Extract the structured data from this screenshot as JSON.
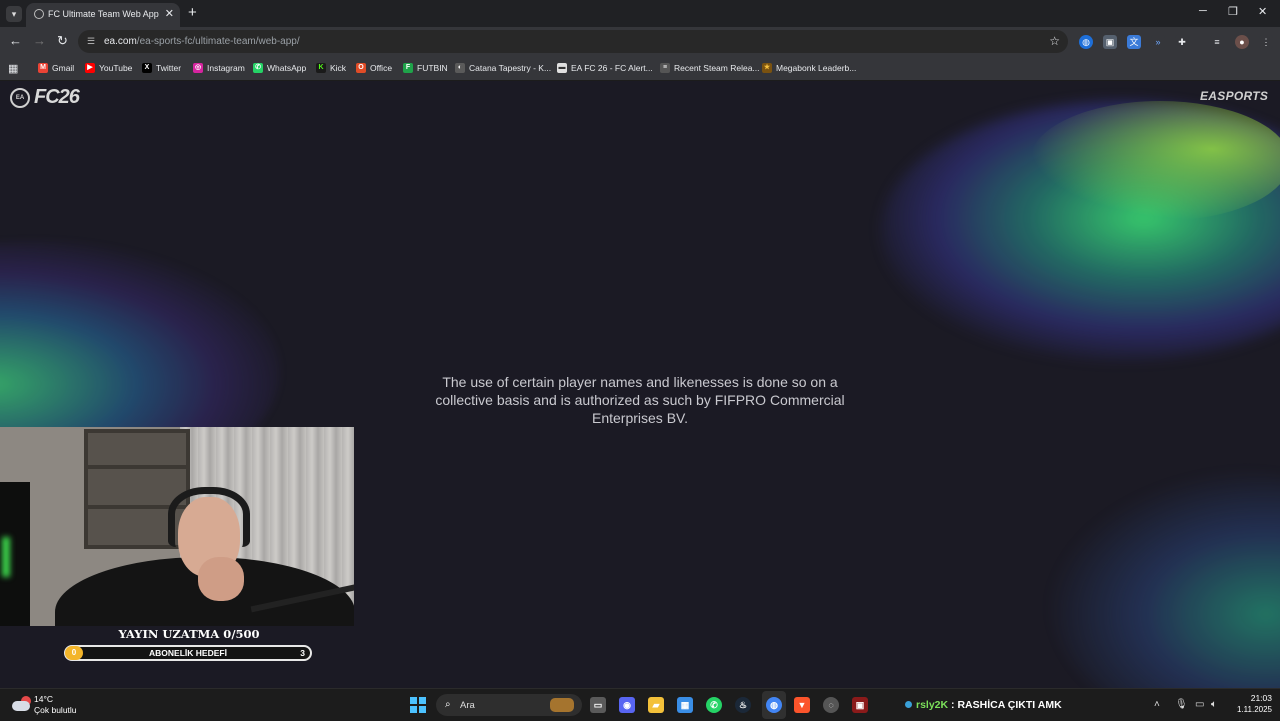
{
  "browser": {
    "tab_title": "FC Ultimate Team Web App - EA",
    "tab_close": "✕",
    "new_tab": "+",
    "window_controls": [
      "─",
      "❐",
      "✕"
    ],
    "url_host": "ea.com",
    "url_path": "/ea-sports-fc/ultimate-team/web-app/",
    "icons": {
      "back": "back-arrow-icon",
      "forward": "forward-arrow-icon",
      "reload": "reload-icon",
      "bookmark_star": "star-icon"
    }
  },
  "bookmarks": [
    {
      "label": "Gmail",
      "color": "#ea4335",
      "glyph": "M"
    },
    {
      "label": "YouTube",
      "color": "#ff0000",
      "glyph": "▶"
    },
    {
      "label": "Twitter",
      "color": "#000000",
      "glyph": "X"
    },
    {
      "label": "Instagram",
      "color": "#d6249f",
      "glyph": "◎"
    },
    {
      "label": "WhatsApp",
      "color": "#25d366",
      "glyph": "✆"
    },
    {
      "label": "Kick",
      "color": "#53fc18",
      "glyph": "K"
    },
    {
      "label": "Office",
      "color": "#e04c27",
      "glyph": "O"
    },
    {
      "label": "FUTBIN",
      "color": "#1fa34a",
      "glyph": "F"
    },
    {
      "label": "Catana Tapestry - K...",
      "color": "#9e9e9e",
      "glyph": "◐"
    },
    {
      "label": "EA FC 26 - FC Alert...",
      "color": "#f1f1f1",
      "glyph": "▬"
    },
    {
      "label": "Recent Steam Relea...",
      "color": "#bdbdbd",
      "glyph": "≡"
    },
    {
      "label": "Megabonk Leaderb...",
      "color": "#e0a020",
      "glyph": "★"
    }
  ],
  "page": {
    "logo_badge": "EA",
    "logo_text": "FC26",
    "brand_right": "EASPORTS",
    "legal_text": "The use of certain player names and likenesses is done so on a collective basis and is authorized as such by FIFPRO Commercial Enterprises BV."
  },
  "stream_overlay": {
    "goal_title": "YAYIN UZATMA 0/500",
    "goal_label": "ABONELİK HEDEFİ",
    "goal_current": "0",
    "goal_target": "3",
    "goal_progress": 0
  },
  "taskbar": {
    "temperature": "14°C",
    "condition": "Çok bulutlu",
    "search_placeholder": "Ara",
    "ticker_user": "rsly2K",
    "ticker_message": " : RASHİCA ÇIKTI AMK",
    "time": "21:03",
    "date": "1.11.2025",
    "apps": [
      {
        "name": "task-view-icon",
        "color": "#5a5a5a",
        "glyph": "▭"
      },
      {
        "name": "discord-icon",
        "color": "#5865f2",
        "glyph": "◉"
      },
      {
        "name": "file-explorer-icon",
        "color": "#f3c13a",
        "glyph": "▰"
      },
      {
        "name": "store-icon",
        "color": "#3a8ee6",
        "glyph": "▦"
      },
      {
        "name": "whatsapp-icon",
        "color": "#25d366",
        "glyph": "✆"
      },
      {
        "name": "steam-icon",
        "color": "#1b2838",
        "glyph": "♨"
      },
      {
        "name": "chrome-icon",
        "color": "#4285f4",
        "glyph": "◍"
      },
      {
        "name": "brave-icon",
        "color": "#fb542b",
        "glyph": "▼"
      },
      {
        "name": "chrome-alt-icon",
        "color": "#555555",
        "glyph": "◌"
      },
      {
        "name": "game-app-icon",
        "color": "#8a1a1a",
        "glyph": "▣"
      }
    ],
    "tray_icons": [
      "chevron-up-icon",
      "microphone-icon",
      "display-icon",
      "volume-icon"
    ]
  }
}
